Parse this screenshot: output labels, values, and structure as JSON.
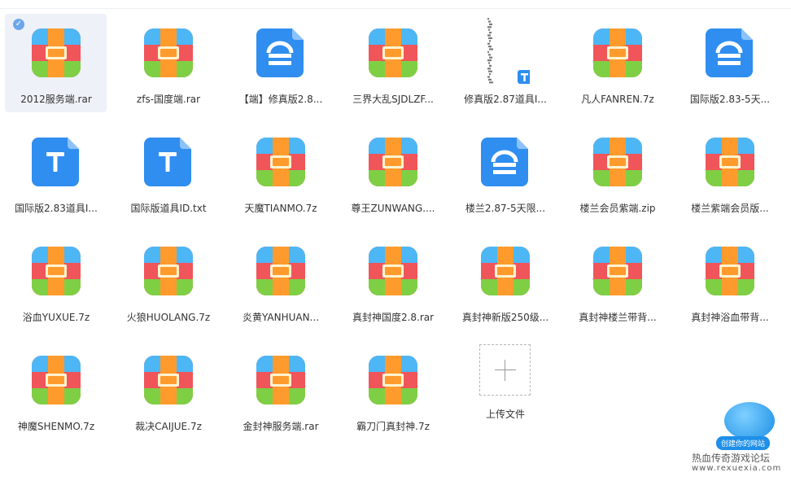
{
  "files": [
    {
      "name": "2012服务端.rar",
      "type": "archive",
      "selected": true
    },
    {
      "name": "zfs-国度端.rar",
      "type": "archive"
    },
    {
      "name": "【端】修真版2.8...",
      "type": "config"
    },
    {
      "name": "三界大乱SJDLZF...",
      "type": "archive"
    },
    {
      "name": "修真版2.87道具I...",
      "type": "image-text"
    },
    {
      "name": "凡人FANREN.7z",
      "type": "archive"
    },
    {
      "name": "国际版2.83-5天...",
      "type": "config"
    },
    {
      "name": "国际版2.83道具I...",
      "type": "text"
    },
    {
      "name": "国际版道具ID.txt",
      "type": "text"
    },
    {
      "name": "天魔TIANMO.7z",
      "type": "archive"
    },
    {
      "name": "尊王ZUNWANG....",
      "type": "archive"
    },
    {
      "name": "楼兰2.87-5天限...",
      "type": "config"
    },
    {
      "name": "楼兰会员紫端.zip",
      "type": "archive"
    },
    {
      "name": "楼兰紫端会员版...",
      "type": "archive"
    },
    {
      "name": "浴血YUXUE.7z",
      "type": "archive"
    },
    {
      "name": "火狼HUOLANG.7z",
      "type": "archive"
    },
    {
      "name": "炎黄YANHUAN...",
      "type": "archive"
    },
    {
      "name": "真封神国度2.8.rar",
      "type": "archive"
    },
    {
      "name": "真封神新版250级...",
      "type": "archive"
    },
    {
      "name": "真封神楼兰带背...",
      "type": "archive"
    },
    {
      "name": "真封神浴血带背...",
      "type": "archive"
    },
    {
      "name": "神魔SHENMO.7z",
      "type": "archive"
    },
    {
      "name": "裁决CAIJUE.7z",
      "type": "archive"
    },
    {
      "name": "金封神服务端.rar",
      "type": "archive"
    },
    {
      "name": "霸刀门真封神.7z",
      "type": "archive"
    }
  ],
  "upload": {
    "label": "上传文件"
  },
  "watermark": {
    "badge": "创建你的网站",
    "text": "热血传奇游戏论坛",
    "url": "www.rexuexia.com"
  },
  "colors": {
    "archive_top": "#4db6f5",
    "archive_mid": "#f0555a",
    "archive_bottom": "#7fcf45",
    "archive_strap": "#ff9b2d",
    "doc_blue": "#2f8ef0"
  }
}
